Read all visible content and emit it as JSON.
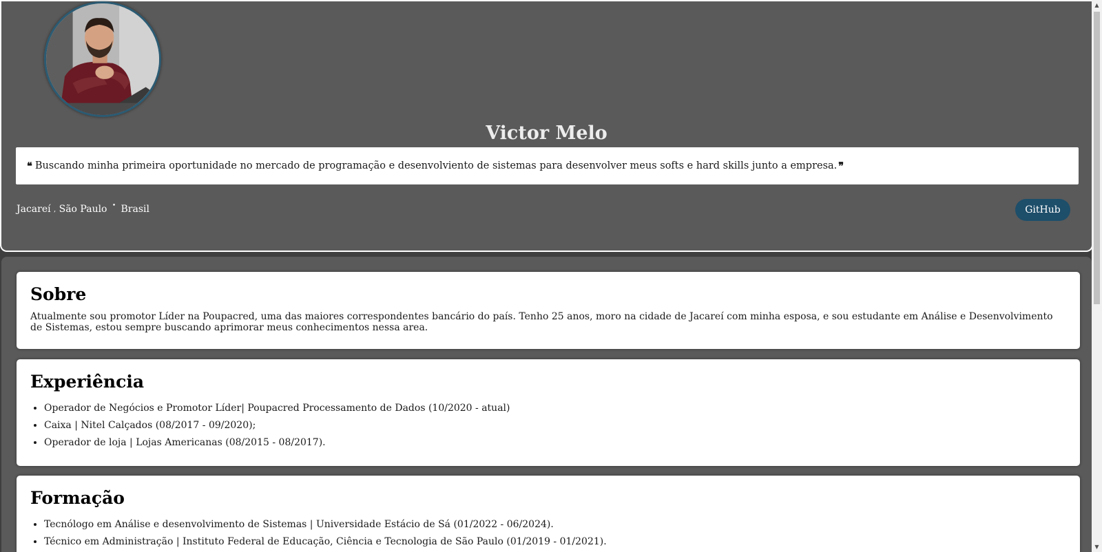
{
  "header": {
    "name": "Victor Melo",
    "quote_open": "❝",
    "quote": "Buscando minha primeira oportunidade no mercado de programação e desenvolviento de sistemas para desenvolver meus softs e hard skills junto a empresa.",
    "quote_close": "❞",
    "location": {
      "city": "Jacareí",
      "separator": ",",
      "state": "São Paulo",
      "dot": "•",
      "country": "Brasil"
    },
    "github_label": "GitHub"
  },
  "sobre": {
    "title": "Sobre",
    "text": "Atualmente sou promotor Líder na Poupacred, uma das maiores correspondentes bancário do país. Tenho 25 anos, moro na cidade de Jacareí com minha esposa, e sou estudante em Análise e Desenvolvimento de Sistemas, estou sempre buscando aprimorar meus conhecimentos nessa area."
  },
  "experiencia": {
    "title": "Experiência",
    "items": [
      "Operador de Negócios e Promotor Líder| Poupacred Processamento de Dados (10/2020 - atual)",
      "Caixa | Nitel Calçados (08/2017 - 09/2020);",
      "Operador de loja | Lojas Americanas (08/2015 - 08/2017)."
    ]
  },
  "formacao": {
    "title": "Formação",
    "items": [
      "Tecnólogo em Análise e desenvolvimento de Sistemas | Universidade Estácio de Sá (01/2022 - 06/2024).",
      "Técnico em Administração | Instituto Federal de Educação, Ciência e Tecnologia de São Paulo (01/2019 - 01/2021)."
    ]
  },
  "colors": {
    "panel_bg": "#5a5a5a",
    "button_bg": "#1d4e6a",
    "avatar_border": "#2b5b73"
  },
  "icons": {
    "scroll_up": "triangle-up-icon",
    "scroll_down": "triangle-down-icon"
  }
}
